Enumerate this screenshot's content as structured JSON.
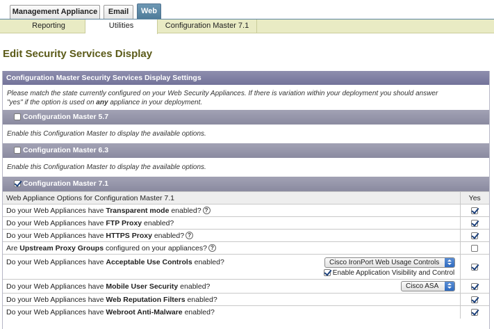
{
  "top_tabs": [
    {
      "label": "Management Appliance",
      "active": false
    },
    {
      "label": "Email",
      "active": false
    },
    {
      "label": "Web",
      "active": true
    }
  ],
  "sub_nav": [
    {
      "label": "Reporting",
      "active": false
    },
    {
      "label": "Utilities",
      "active": true
    },
    {
      "label": "Configuration Master 7.1",
      "active": false
    }
  ],
  "page_title": "Edit Security Services Display",
  "panel": {
    "title": "Configuration Master Security Services Display Settings",
    "intro_part1": "Please match the state currently configured on your Web Security Appliances. If there is variation within your deployment you should answer",
    "intro_part2": "\"yes\" if the option is used on",
    "intro_bold": "any",
    "intro_part3": "appliance in your deployment."
  },
  "config_masters": [
    {
      "label": "Configuration Master 5.7",
      "checked": false,
      "description": "Enable this Configuration Master to display the available options."
    },
    {
      "label": "Configuration Master 6.3",
      "checked": false,
      "description": "Enable this Configuration Master to display the available options."
    },
    {
      "label": "Configuration Master 7.1",
      "checked": true
    }
  ],
  "options_table": {
    "header_label": "Web Appliance Options for Configuration Master 7.1",
    "header_yes": "Yes",
    "rows": [
      {
        "prefix": "Do your Web Appliances have ",
        "bold": "Transparent mode",
        "suffix": " enabled?",
        "help": true,
        "checked": true
      },
      {
        "prefix": "Do your Web Appliances have ",
        "bold": "FTP Proxy",
        "suffix": " enabled?",
        "help": false,
        "checked": true
      },
      {
        "prefix": "Do your Web Appliances have ",
        "bold": "HTTPS Proxy",
        "suffix": " enabled?",
        "help": true,
        "checked": true
      },
      {
        "prefix": "Are ",
        "bold": "Upstream Proxy Groups",
        "suffix": " configured on your appliances?",
        "help": true,
        "checked": false
      },
      {
        "prefix": "Do your Web Appliances have ",
        "bold": "Acceptable Use Controls",
        "suffix": " enabled?",
        "help": false,
        "checked": true,
        "select_value": "Cisco IronPort Web Usage Controls",
        "sub_checkbox_label": "Enable Application Visibility and Control",
        "sub_checked": true
      },
      {
        "prefix": "Do your Web Appliances have ",
        "bold": "Mobile User Security",
        "suffix": " enabled?",
        "help": false,
        "checked": true,
        "select_value": "Cisco ASA"
      },
      {
        "prefix": "Do your Web Appliances have ",
        "bold": "Web Reputation Filters",
        "suffix": " enabled?",
        "help": false,
        "checked": true
      },
      {
        "prefix": "Do your Web Appliances have ",
        "bold": "Webroot Anti-Malware",
        "suffix": " enabled?",
        "help": false,
        "checked": true
      }
    ]
  },
  "help_glyph": "?",
  "colors": {
    "tab_active": "#5b86a6",
    "subnav_bg": "#e9ebc4",
    "title_color": "#5b5a18",
    "panel_header": "#7f7fa3",
    "section_header": "#9898ae"
  }
}
